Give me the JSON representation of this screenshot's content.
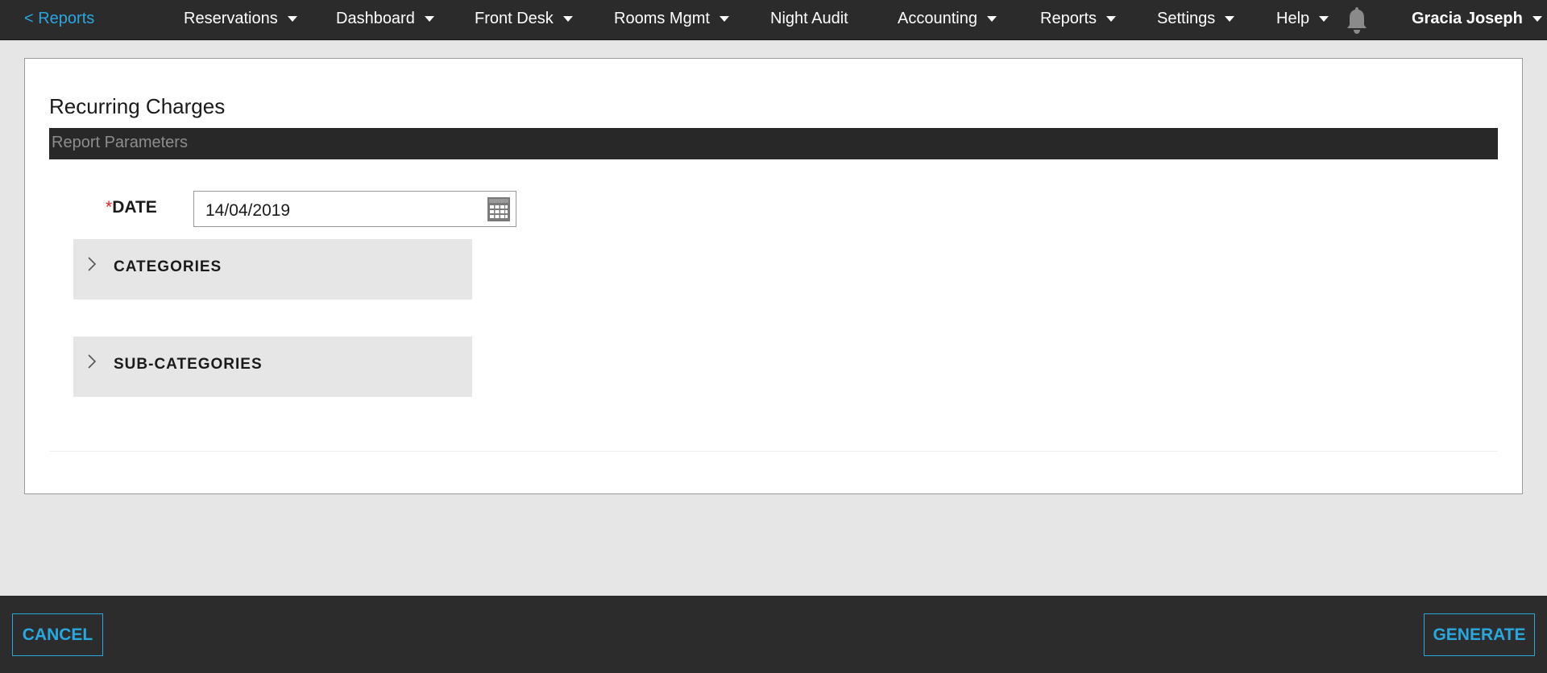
{
  "topbar": {
    "back_label": "< Reports",
    "nav": [
      {
        "label": "Reservations",
        "has_dropdown": true
      },
      {
        "label": "Dashboard",
        "has_dropdown": true
      },
      {
        "label": "Front Desk",
        "has_dropdown": true
      },
      {
        "label": "Rooms Mgmt",
        "has_dropdown": true
      },
      {
        "label": "Night Audit",
        "has_dropdown": false
      },
      {
        "label": "Accounting",
        "has_dropdown": true
      },
      {
        "label": "Reports",
        "has_dropdown": true
      },
      {
        "label": "Settings",
        "has_dropdown": true
      },
      {
        "label": "Help",
        "has_dropdown": true
      }
    ],
    "notification_icon": "bell-icon",
    "user_name": "Gracia Joseph"
  },
  "report": {
    "title": "Recurring Charges",
    "section_header": "Report Parameters",
    "date_required_mark": "*",
    "date_label": "DATE",
    "date_value": "14/04/2019",
    "calendar_icon": "calendar-icon",
    "accordions": [
      {
        "label": "CATEGORIES",
        "icon": "chevron-right-icon"
      },
      {
        "label": "SUB-CATEGORIES",
        "icon": "chevron-right-icon"
      }
    ]
  },
  "footer": {
    "cancel_label": "CANCEL",
    "generate_label": "GENERATE"
  },
  "colors": {
    "accent": "#29a8e0",
    "topbar_bg": "#2b2b2b",
    "footer_bg": "#2c2c2c",
    "required": "#e02020"
  }
}
